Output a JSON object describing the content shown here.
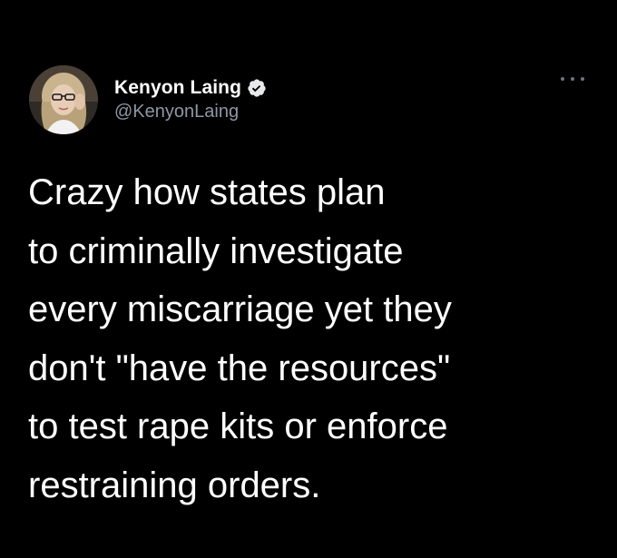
{
  "tweet": {
    "author": {
      "display_name": "Kenyon Laing",
      "handle": "@KenyonLaing",
      "verified": true,
      "avatar_icon": "profile-photo"
    },
    "more_icon": "more-horizontal-icon",
    "text_lines": [
      "Crazy how states plan",
      "to criminally investigate",
      "every miscarriage yet they",
      "don't \"have the resources\"",
      "to test rape kits or enforce",
      "restraining orders."
    ]
  },
  "colors": {
    "background": "#000000",
    "text": "#ffffff",
    "secondary_text": "#8b98a5",
    "verified_badge": "#e7e9ea"
  }
}
